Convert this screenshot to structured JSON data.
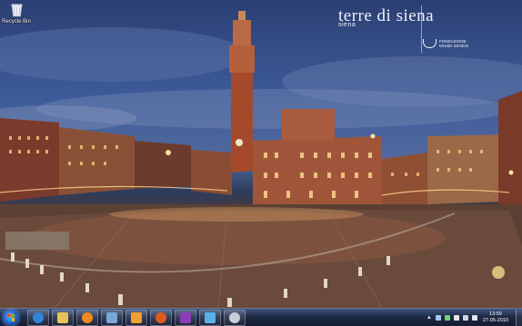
{
  "desktop": {
    "icons": [
      {
        "label": "Recycle Bin",
        "icon": "recycle-bin-icon"
      }
    ],
    "branding": {
      "title": "terre di siena",
      "subtitle": "siena",
      "logo_text": "FONDAZIONE MUSEI SENESI"
    }
  },
  "taskbar": {
    "start_icon": "windows-start-icon",
    "pinned": [
      {
        "name": "ie",
        "icon": "internet-explorer-icon",
        "color": "#2f86d8"
      },
      {
        "name": "explorer",
        "icon": "folder-icon",
        "color": "#e8c35a"
      },
      {
        "name": "media-player",
        "icon": "media-player-icon",
        "color": "#f08a1c"
      },
      {
        "name": "paint",
        "icon": "paint-icon",
        "color": "#7aa7d9"
      },
      {
        "name": "outlook",
        "icon": "outlook-icon",
        "color": "#f0a030"
      },
      {
        "name": "firefox",
        "icon": "firefox-icon",
        "color": "#e05a18"
      },
      {
        "name": "onenote",
        "icon": "onenote-icon",
        "color": "#8a3fb5"
      },
      {
        "name": "photos",
        "icon": "photo-icon",
        "color": "#5cb0e8"
      },
      {
        "name": "ghost-app",
        "icon": "ghost-icon",
        "color": "#c9cfd8"
      }
    ],
    "tray": {
      "icons": [
        "network-icon",
        "security-icon",
        "flag-icon",
        "battery-icon",
        "volume-icon"
      ],
      "time": "13:59",
      "date": "27-05-2010"
    }
  }
}
